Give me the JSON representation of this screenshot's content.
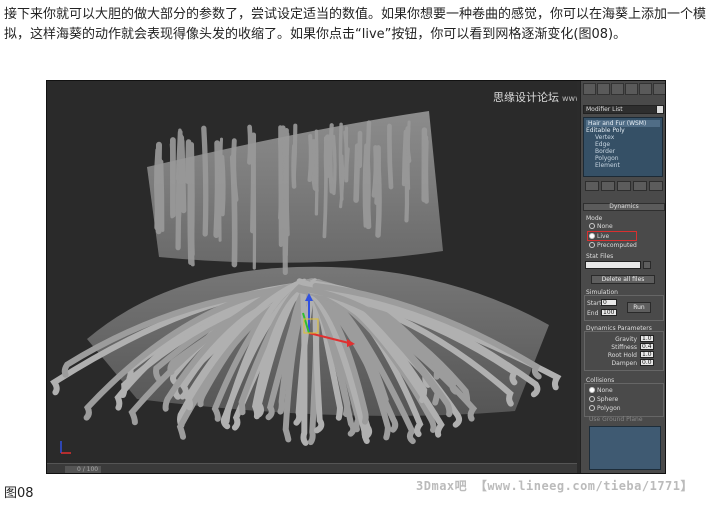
{
  "article": {
    "paragraph": "接下来你就可以大胆的做大部分的参数了，尝试设定适当的数值。如果你想要一种卷曲的感觉，你可以在海葵上添加一个模拟，这样海葵的动作就会表现得像头发的收缩了。如果你点击“live”按钮，你可以看到网格逐渐变化(图08)。",
    "caption": "图08",
    "footer_watermark": "3Dmax吧 【www.lineeg.com/tieba/1771】"
  },
  "viewport": {
    "site_watermark": "思缘设计论坛",
    "site_watermark_sub": "www.MISSYUAN.com",
    "frame_readout": "0 / 100"
  },
  "panel": {
    "modifier_list": "Modifier List",
    "stack": {
      "hair_modifier": "Hair and Fur (WSM)",
      "base_object": "Editable Poly",
      "sub_items": [
        "Vertex",
        "Edge",
        "Border",
        "Polygon",
        "Element"
      ]
    },
    "dynamics": {
      "title": "Dynamics",
      "mode_label": "Mode",
      "mode_options": [
        "None",
        "Live",
        "Precomputed"
      ],
      "mode_selected": "Live",
      "stat_files_label": "Stat Files",
      "delete_all_files": "Delete all files",
      "simulation_label": "Simulation",
      "start_label": "Start",
      "start_value": "0",
      "end_label": "End",
      "end_value": "100",
      "run_button": "Run",
      "params_label": "Dynamics Parameters",
      "params": [
        {
          "label": "Gravity",
          "value": "1.0"
        },
        {
          "label": "Stiffness",
          "value": "0.4"
        },
        {
          "label": "Root Hold",
          "value": "1.0"
        },
        {
          "label": "Dampen",
          "value": "0.0"
        }
      ],
      "collisions_label": "Collisions",
      "collision_options": [
        "None",
        "Sphere",
        "Polygon"
      ],
      "collision_selected": "None",
      "use_ground_plane": "Use Ground Plane"
    }
  },
  "colors": {
    "viewport_bg": "#2a2a2a",
    "stack_bg": "#355066",
    "highlight": "#d83030",
    "axis_x": "#e03030",
    "axis_y": "#30c030",
    "axis_z": "#3050e0"
  }
}
